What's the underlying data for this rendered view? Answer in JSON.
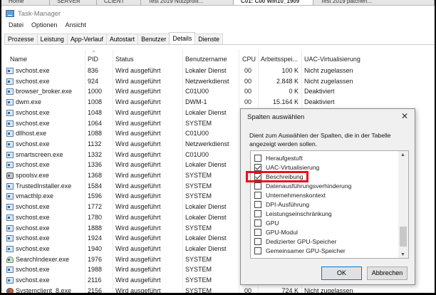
{
  "vm_tabs": [
    {
      "label": "Home",
      "active": false
    },
    {
      "label": "SERVER",
      "active": false
    },
    {
      "label": "CLIENT",
      "active": false
    },
    {
      "label": "Test 2019 Nutzprofil...",
      "active": false
    },
    {
      "label": "C01: C00 Win10_1909",
      "active": true
    },
    {
      "label": "Test 2019 patchen...",
      "active": false
    }
  ],
  "window": {
    "title": "Task-Manager"
  },
  "menu": [
    "Datei",
    "Optionen",
    "Ansicht"
  ],
  "tabs": [
    {
      "label": "Prozesse",
      "active": false
    },
    {
      "label": "Leistung",
      "active": false
    },
    {
      "label": "App-Verlauf",
      "active": false
    },
    {
      "label": "Autostart",
      "active": false
    },
    {
      "label": "Benutzer",
      "active": false
    },
    {
      "label": "Details",
      "active": true
    },
    {
      "label": "Dienste",
      "active": false
    }
  ],
  "table": {
    "columns": [
      "Name",
      "PID",
      "Status",
      "Benutzername",
      "CPU",
      "Arbeitsspei...",
      "UAC-Virtualisierung"
    ],
    "sorted_column": "PID",
    "rows": [
      {
        "icon": "service",
        "name": "svchost.exe",
        "pid": "836",
        "status": "Wird ausgeführt",
        "user": "Lokaler Dienst",
        "cpu": "00",
        "mem": "100 K",
        "uac": "Nicht zugelassen"
      },
      {
        "icon": "service",
        "name": "svchost.exe",
        "pid": "924",
        "status": "Wird ausgeführt",
        "user": "Netzwerkdienst",
        "cpu": "00",
        "mem": "2.848 K",
        "uac": "Nicht zugelassen"
      },
      {
        "icon": "service",
        "name": "browser_broker.exe",
        "pid": "1000",
        "status": "Wird ausgeführt",
        "user": "C01U00",
        "cpu": "00",
        "mem": "0 K",
        "uac": "Deaktiviert"
      },
      {
        "icon": "service",
        "name": "dwm.exe",
        "pid": "1008",
        "status": "Wird ausgeführt",
        "user": "DWM-1",
        "cpu": "00",
        "mem": "15.164 K",
        "uac": "Deaktiviert"
      },
      {
        "icon": "service",
        "name": "svchost.exe",
        "pid": "1048",
        "status": "Wird ausgeführt",
        "user": "Lokaler Dienst"
      },
      {
        "icon": "service",
        "name": "svchost.exe",
        "pid": "1064",
        "status": "Wird ausgeführt",
        "user": "SYSTEM"
      },
      {
        "icon": "service",
        "name": "dllhost.exe",
        "pid": "1088",
        "status": "Wird ausgeführt",
        "user": "C01U00"
      },
      {
        "icon": "service",
        "name": "svchost.exe",
        "pid": "1132",
        "status": "Wird ausgeführt",
        "user": "Netzwerkdienst"
      },
      {
        "icon": "service",
        "name": "smartscreen.exe",
        "pid": "1332",
        "status": "Wird ausgeführt",
        "user": "C01U00"
      },
      {
        "icon": "service",
        "name": "svchost.exe",
        "pid": "1336",
        "status": "Wird ausgeführt",
        "user": "Lokaler Dienst"
      },
      {
        "icon": "printer",
        "name": "spoolsv.exe",
        "pid": "1368",
        "status": "Wird ausgeführt",
        "user": "SYSTEM"
      },
      {
        "icon": "service",
        "name": "TrustedInstaller.exe",
        "pid": "1584",
        "status": "Wird ausgeführt",
        "user": "SYSTEM"
      },
      {
        "icon": "service",
        "name": "vmacthlp.exe",
        "pid": "1596",
        "status": "Wird ausgeführt",
        "user": "SYSTEM"
      },
      {
        "icon": "service",
        "name": "svchost.exe",
        "pid": "1772",
        "status": "Wird ausgeführt",
        "user": "Lokaler Dienst"
      },
      {
        "icon": "service",
        "name": "svchost.exe",
        "pid": "1780",
        "status": "Wird ausgeführt",
        "user": "Lokaler Dienst"
      },
      {
        "icon": "service",
        "name": "svchost.exe",
        "pid": "1888",
        "status": "Wird ausgeführt",
        "user": "SYSTEM"
      },
      {
        "icon": "service",
        "name": "svchost.exe",
        "pid": "1924",
        "status": "Wird ausgeführt",
        "user": "Lokaler Dienst"
      },
      {
        "icon": "service",
        "name": "svchost.exe",
        "pid": "1940",
        "status": "Wird ausgeführt",
        "user": "Lokaler Dienst"
      },
      {
        "icon": "search",
        "name": "SearchIndexer.exe",
        "pid": "1976",
        "status": "Wird ausgeführt",
        "user": "SYSTEM"
      },
      {
        "icon": "service",
        "name": "svchost.exe",
        "pid": "1988",
        "status": "Wird ausgeführt",
        "user": "SYSTEM"
      },
      {
        "icon": "service",
        "name": "svchost.exe",
        "pid": "2116",
        "status": "Wird ausgeführt",
        "user": "SYSTEM"
      },
      {
        "icon": "sysclient",
        "name": "Systemclient_8.exe",
        "pid": "2156",
        "status": "Wird ausgeführt",
        "user": "SYSTEM",
        "cpu": "00",
        "mem": "724 K",
        "uac": "Nicht zugelassen"
      }
    ]
  },
  "dialog": {
    "title": "Spalten auswählen",
    "close_icon": "close-icon",
    "description": "Dient zum Auswählen der Spalten, die in der Tabelle angezeigt werden sollen.",
    "items": [
      {
        "label": "Heraufgestuft",
        "checked": false
      },
      {
        "label": "UAC-Virtualisierung",
        "checked": true
      },
      {
        "label": "Beschreibung",
        "checked": true,
        "highlighted": true
      },
      {
        "label": "Datenausführungsverhinderung",
        "checked": false
      },
      {
        "label": "Unternehmenskontext",
        "checked": false
      },
      {
        "label": "DPI-Ausführung",
        "checked": false
      },
      {
        "label": "Leistungseinschränkung",
        "checked": false
      },
      {
        "label": "GPU",
        "checked": false
      },
      {
        "label": "GPU-Modul",
        "checked": false
      },
      {
        "label": "Dedizierter GPU-Speicher",
        "checked": false
      },
      {
        "label": "Gemeinsamer GPU-Speicher",
        "checked": false
      }
    ],
    "ok_label": "OK",
    "cancel_label": "Abbrechen",
    "highlight_color": "#e8101a"
  }
}
